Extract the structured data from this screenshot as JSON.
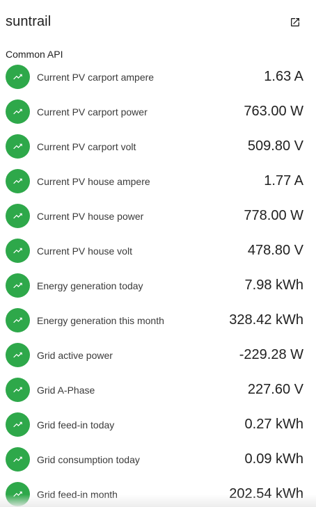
{
  "card": {
    "title": "suntrail",
    "section_label": "Common API",
    "open_icon": "open-in-new-icon"
  },
  "entity_icon": "trending-up-icon",
  "colors": {
    "badge": "#2ea84a"
  },
  "entities": [
    {
      "label": "Current PV carport ampere",
      "value": "1.63 A"
    },
    {
      "label": "Current PV carport power",
      "value": "763.00 W"
    },
    {
      "label": "Current PV carport volt",
      "value": "509.80 V"
    },
    {
      "label": "Current PV house ampere",
      "value": "1.77 A"
    },
    {
      "label": "Current PV house power",
      "value": "778.00 W"
    },
    {
      "label": "Current PV house volt",
      "value": "478.80 V"
    },
    {
      "label": "Energy generation today",
      "value": "7.98 kWh"
    },
    {
      "label": "Energy generation this month",
      "value": "328.42 kWh"
    },
    {
      "label": "Grid active power",
      "value": "-229.28 W"
    },
    {
      "label": "Grid A-Phase",
      "value": "227.60 V"
    },
    {
      "label": "Grid feed-in today",
      "value": "0.27 kWh"
    },
    {
      "label": "Grid consumption today",
      "value": "0.09 kWh"
    },
    {
      "label": "Grid feed-in month",
      "value": "202.54 kWh"
    }
  ]
}
